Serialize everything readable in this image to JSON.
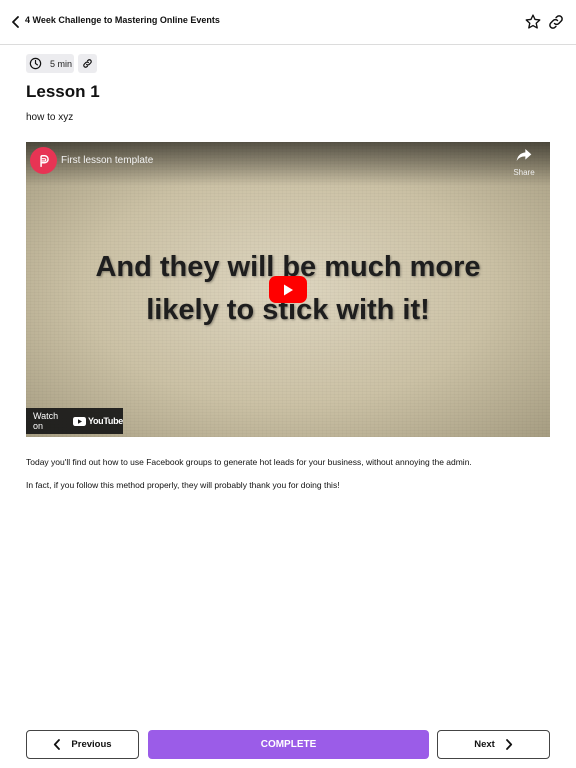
{
  "header": {
    "course_title": "4 Week Challenge to Mastering Online Events",
    "icons": {
      "back": "chevron-left-icon",
      "favorite": "star-icon",
      "share": "link-icon"
    }
  },
  "lesson": {
    "duration": "5 min",
    "title": "Lesson 1",
    "subtitle": "how to xyz"
  },
  "video": {
    "title": "First lesson template",
    "share_label": "Share",
    "slide_line_1": "And they will be much more",
    "slide_line_2": "likely to stick with it!",
    "watch_on_label": "Watch on",
    "youtube_wordmark": "YouTube",
    "colors": {
      "play": "#ff0000",
      "avatar": "#e73454"
    }
  },
  "content": {
    "paragraphs": [
      "Today you'll find out how to use Facebook groups to generate hot leads for your business, without annoying the admin.",
      "In fact, if you follow this method properly, they will probably thank you for doing this!"
    ]
  },
  "footer": {
    "previous_label": "Previous",
    "complete_label": "COMPLETE",
    "next_label": "Next",
    "colors": {
      "complete": "#9b5ce8"
    }
  }
}
